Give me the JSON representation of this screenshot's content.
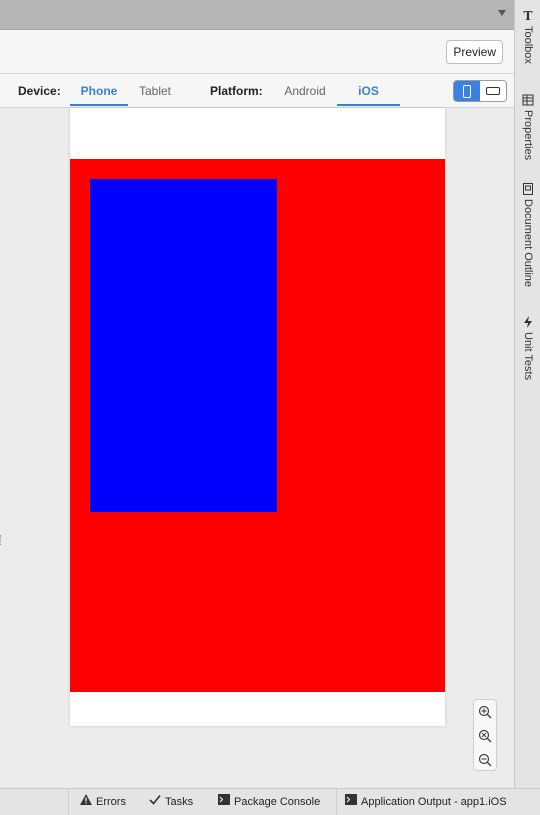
{
  "toolbar": {
    "preview_label": "Preview"
  },
  "device_bar": {
    "device_label": "Device:",
    "device_tabs": [
      "Phone",
      "Tablet"
    ],
    "device_selected": "Phone",
    "platform_label": "Platform:",
    "platform_tabs": [
      "Android",
      "iOS"
    ],
    "platform_selected": "iOS",
    "orientation_selected": "portrait"
  },
  "canvas": {
    "outer_view_color": "#ff0000",
    "inner_view_color": "#0000ff",
    "zoom_buttons": [
      "zoom-in-icon",
      "zoom-fit-icon",
      "zoom-out-icon"
    ]
  },
  "right_dock": {
    "items": [
      {
        "label": "Toolbox",
        "icon": "toolbox-icon"
      },
      {
        "label": "Properties",
        "icon": "properties-icon"
      },
      {
        "label": "Document Outline",
        "icon": "document-outline-icon"
      },
      {
        "label": "Unit Tests",
        "icon": "unit-tests-icon"
      }
    ]
  },
  "status_bar": {
    "items": [
      {
        "label": "Errors",
        "icon": "warning-icon"
      },
      {
        "label": "Tasks",
        "icon": "checkmark-icon"
      },
      {
        "label": "Package Console",
        "icon": "console-icon"
      },
      {
        "label": "Application Output - app1.iOS",
        "icon": "console-icon"
      }
    ]
  },
  "colors": {
    "accent": "#3b7fd1"
  }
}
